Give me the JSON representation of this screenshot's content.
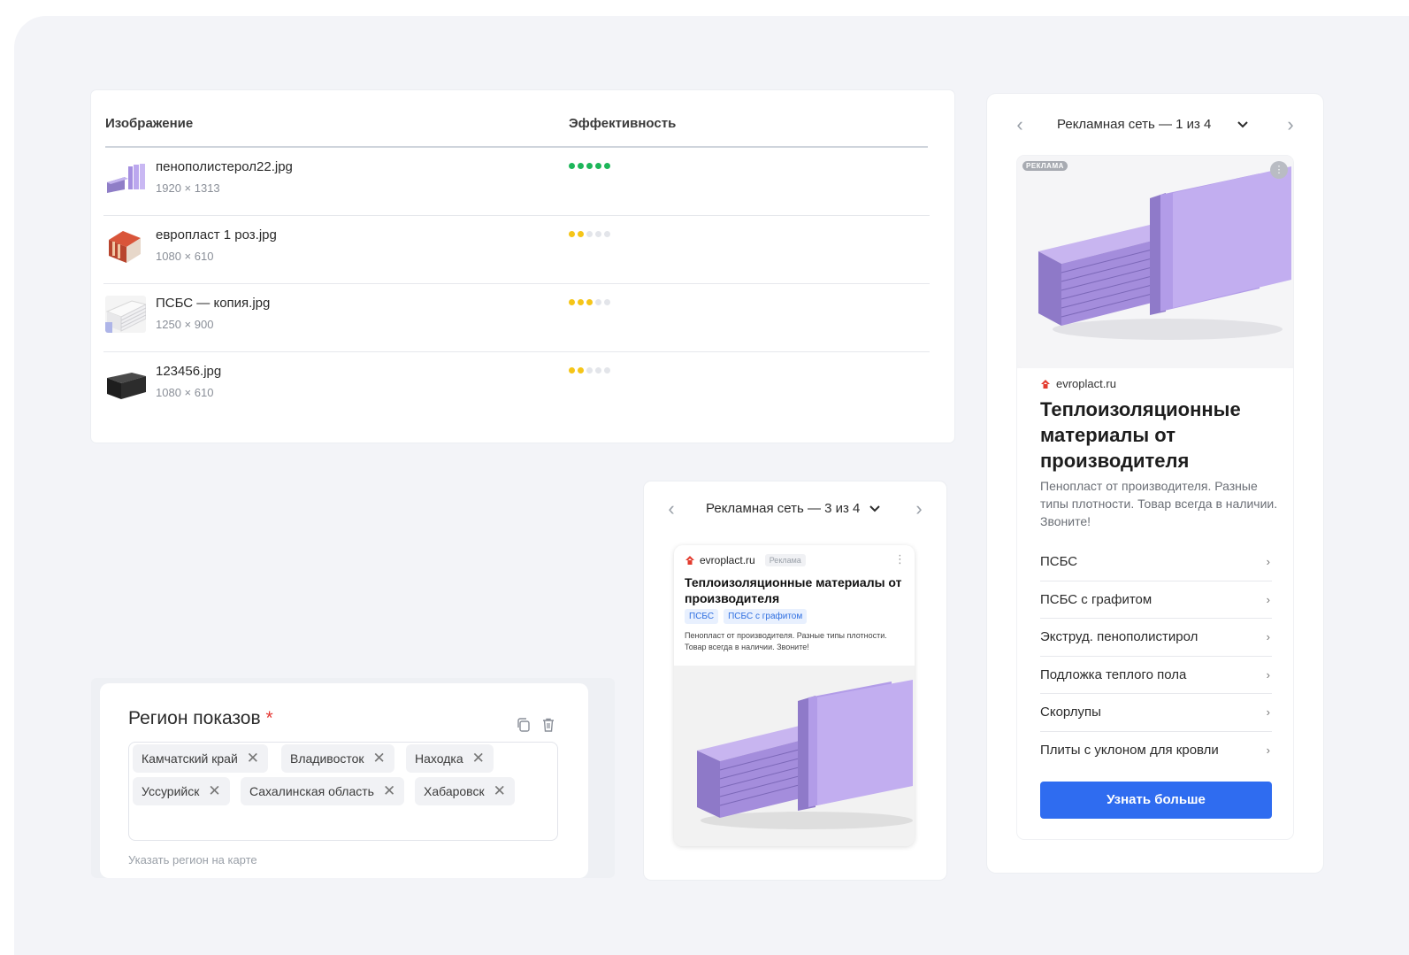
{
  "table": {
    "header_image": "Изображение",
    "header_efficiency": "Эффективность",
    "rows": [
      {
        "name": "пенополистерол22.jpg",
        "size": "1920 × 1313",
        "rating": 5,
        "color": "#1eb65a"
      },
      {
        "name": "европласт 1 роз.jpg",
        "size": "1080 × 610",
        "rating": 2,
        "color": "#f5c518"
      },
      {
        "name": "ПСБС — копия.jpg",
        "size": "1250 × 900",
        "rating": 3,
        "color": "#f5c518"
      },
      {
        "name": "123456.jpg",
        "size": "1080 × 610",
        "rating": 2,
        "color": "#f5c518"
      }
    ]
  },
  "region": {
    "title": "Регион показов",
    "required_mark": "*",
    "tags": [
      "Камчатский край",
      "Владивосток",
      "Находка",
      "Уссурийск",
      "Сахалинская область",
      "Хабаровск"
    ],
    "hint": "Указать регион на карте"
  },
  "mid_preview": {
    "nav_label": "Рекламная сеть — 3 из 4",
    "domain": "evroplact.ru",
    "badge": "Реклама",
    "title": "Теплоизоляционные материалы от производителя",
    "chips": [
      "ПСБС",
      "ПСБС с графитом"
    ],
    "description": "Пенопласт от производителя. Разные типы плотности. Товар всегда в наличии. Звоните!"
  },
  "right_preview": {
    "nav_label": "Рекламная сеть — 1 из 4",
    "ad_label": "РЕКЛАМА",
    "domain": "evroplact.ru",
    "title": "Теплоизоляционные материалы от производителя",
    "description": "Пенопласт от производителя. Разные типы плотности. Товар всегда в наличии. Звоните!",
    "links": [
      "ПСБС",
      "ПСБС с графитом",
      "Экструд. пенополистирол",
      "Подложка теплого пола",
      "Скорлупы",
      "Плиты с уклоном для кровли"
    ],
    "cta": "Узнать больше"
  },
  "colors": {
    "accent": "#2f6cf0",
    "rating_green": "#1eb65a",
    "rating_yellow": "#f5c518",
    "product_purple": "#b9a3e3"
  }
}
